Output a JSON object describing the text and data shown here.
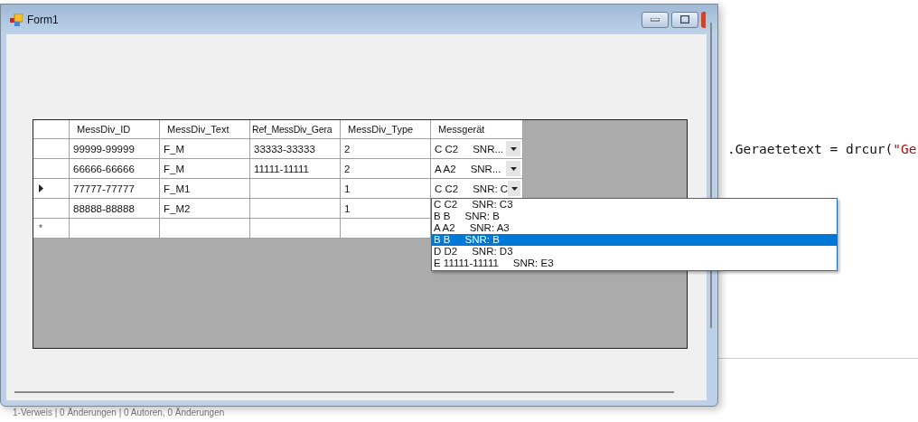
{
  "window": {
    "title": "Form1"
  },
  "grid": {
    "columns": [
      "MessDiv_ID",
      "MessDiv_Text",
      "Ref_MessDiv_Gera",
      "MessDiv_Type",
      "Messgerät"
    ],
    "rows": [
      {
        "current": false,
        "cells": [
          "99999-99999",
          "F_M",
          "33333-33333",
          "2",
          "C C2     SNR..."
        ]
      },
      {
        "current": false,
        "cells": [
          "66666-66666",
          "F_M",
          "11111-11111",
          "2",
          "A A2     SNR..."
        ]
      },
      {
        "current": true,
        "cells": [
          "77777-77777",
          "F_M1",
          "",
          "1",
          "C C2     SNR: C"
        ]
      },
      {
        "current": false,
        "cells": [
          "88888-88888",
          "F_M2",
          "",
          "1",
          ""
        ]
      }
    ],
    "new_row_marker": "*"
  },
  "dropdown": {
    "items": [
      {
        "text": "C C2     SNR: C3",
        "selected": false
      },
      {
        "text": "B B     SNR: B",
        "selected": false
      },
      {
        "text": "A A2     SNR: A3",
        "selected": false
      },
      {
        "text": "B B     SNR: B",
        "selected": true
      },
      {
        "text": "D D2     SNR: D3",
        "selected": false
      },
      {
        "text": "E 11111-11111     SNR: E3",
        "selected": false
      }
    ]
  },
  "editor": {
    "code": ".Geraetetext = drcur(",
    "string": "\"Ge"
  },
  "status_bar": "1-Verweis | 0 Änderungen | 0 Autoren, 0 Änderungen"
}
